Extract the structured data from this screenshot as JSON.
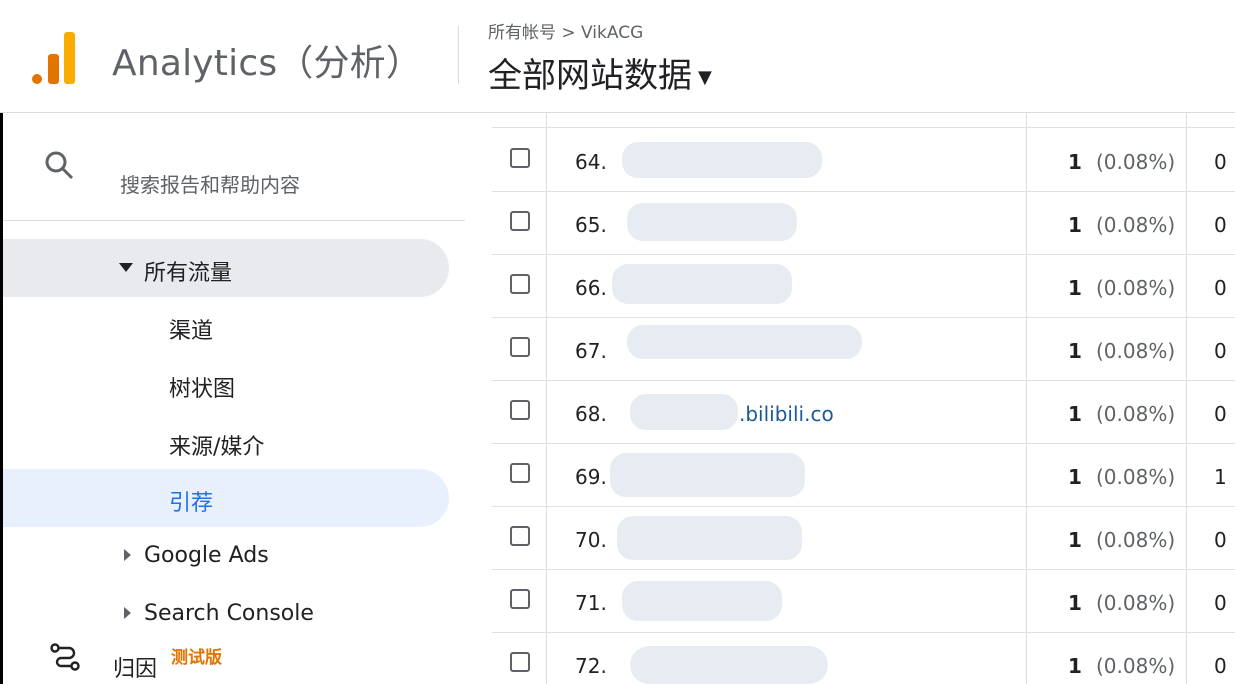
{
  "header": {
    "app_title": "Analytics（分析）",
    "breadcrumb": "所有帐号 > VikACG",
    "property": "全部网站数据"
  },
  "sidebar": {
    "search_label": "搜索报告和帮助内容",
    "items": [
      {
        "label": "所有流量"
      },
      {
        "label": "渠道"
      },
      {
        "label": "树状图"
      },
      {
        "label": "来源/媒介"
      },
      {
        "label": "引荐"
      },
      {
        "label": "Google Ads"
      },
      {
        "label": "Search Console"
      }
    ],
    "attribution": {
      "label": "归因",
      "badge": "测试版"
    }
  },
  "table": {
    "rows": [
      {
        "index": "64.",
        "source": "",
        "value": "1",
        "percent": "(0.08%)",
        "extra": "0"
      },
      {
        "index": "65.",
        "source": "",
        "value": "1",
        "percent": "(0.08%)",
        "extra": "0"
      },
      {
        "index": "66.",
        "source": "",
        "value": "1",
        "percent": "(0.08%)",
        "extra": "0"
      },
      {
        "index": "67.",
        "source": "",
        "value": "1",
        "percent": "(0.08%)",
        "extra": "0"
      },
      {
        "index": "68.",
        "source": ".bilibili.co",
        "value": "1",
        "percent": "(0.08%)",
        "extra": "0"
      },
      {
        "index": "69.",
        "source": "",
        "value": "1",
        "percent": "(0.08%)",
        "extra": "1"
      },
      {
        "index": "70.",
        "source": "",
        "value": "1",
        "percent": "(0.08%)",
        "extra": "0"
      },
      {
        "index": "71.",
        "source": "",
        "value": "1",
        "percent": "(0.08%)",
        "extra": "0"
      },
      {
        "index": "72.",
        "source": "",
        "value": "1",
        "percent": "(0.08%)",
        "extra": "0"
      }
    ]
  },
  "colors": {
    "accent": "#1a73e8",
    "logo_orange": "#e37400",
    "logo_yellow": "#f9ab00",
    "link": "#1a5a96"
  }
}
